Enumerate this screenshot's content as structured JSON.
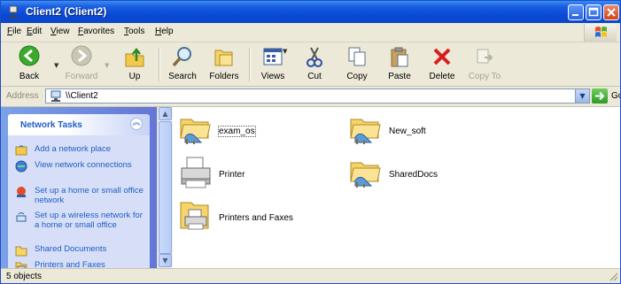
{
  "window": {
    "title": "Client2 (Client2)"
  },
  "menu": [
    "File",
    "Edit",
    "View",
    "Favorites",
    "Tools",
    "Help"
  ],
  "toolbar": {
    "back": "Back",
    "forward": "Forward",
    "up": "Up",
    "search": "Search",
    "folders": "Folders",
    "views": "Views",
    "cut": "Cut",
    "copy": "Copy",
    "paste": "Paste",
    "delete": "Delete",
    "copy_to": "Copy To"
  },
  "address": {
    "label": "Address",
    "value": "\\\\Client2",
    "go": "Go"
  },
  "tasks": {
    "title": "Network Tasks",
    "items": [
      "Add a network place",
      "View network connections",
      "Set up a home or small office network",
      "Set up a wireless network for a home or small office",
      "Shared Documents",
      "Printers and Faxes"
    ]
  },
  "items": [
    {
      "name": "exam_os",
      "icon": "shared-folder-icon"
    },
    {
      "name": "New_soft",
      "icon": "shared-folder-icon"
    },
    {
      "name": "Printer",
      "icon": "printer-icon"
    },
    {
      "name": "SharedDocs",
      "icon": "shared-folder-icon"
    },
    {
      "name": "Printers and Faxes",
      "icon": "printers-folder-icon"
    }
  ],
  "status": {
    "text": "5 objects"
  },
  "colors": {
    "title_bar": "#0b4ad8",
    "task_link": "#215dc6",
    "toolbar_bg": "#ece9d8"
  }
}
